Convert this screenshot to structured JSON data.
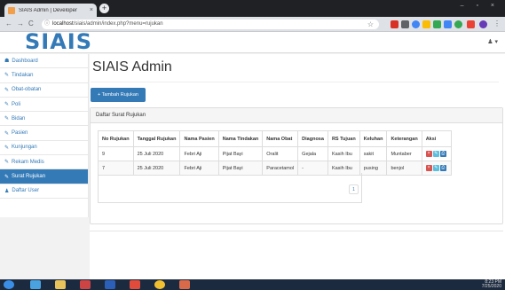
{
  "browser": {
    "tab_title": "SIAIS Admin | Developer",
    "tab_close": "×",
    "new_tab": "+",
    "window_controls": "– ▫ ×",
    "url_host": "localhost",
    "url_path": "/siais/admin/index.php?menu=rujukan",
    "nav_back": "←",
    "nav_forward": "→",
    "nav_reload": "C",
    "info_icon": "ⓘ",
    "star": "☆"
  },
  "app": {
    "brand": "SIAIS",
    "user_menu": "♟ ▾"
  },
  "sidebar": {
    "items": [
      {
        "icon": "☗",
        "label": "Dashboard"
      },
      {
        "icon": "✎",
        "label": "Tindakan"
      },
      {
        "icon": "✎",
        "label": "Obat-obatan"
      },
      {
        "icon": "✎",
        "label": "Poli"
      },
      {
        "icon": "✎",
        "label": "Bidan"
      },
      {
        "icon": "✎",
        "label": "Pasien"
      },
      {
        "icon": "✎",
        "label": "Kunjungan"
      },
      {
        "icon": "✎",
        "label": "Rekam Medis"
      },
      {
        "icon": "✎",
        "label": "Surat Rujukan"
      },
      {
        "icon": "♟",
        "label": "Daftar User"
      }
    ],
    "active_index": 8
  },
  "main": {
    "title": "SIAIS Admin",
    "add_button": "+ Tambah Rujukan",
    "panel_title": "Daftar Surat Rujukan",
    "table": {
      "headers": [
        "No Rujukan",
        "Tanggal Rujukan",
        "Nama Pasien",
        "Nama Tindakan",
        "Nama Obat",
        "Diagnosa",
        "RS Tujuan",
        "Keluhan",
        "Keterangan",
        "Aksi"
      ],
      "rows": [
        [
          "9",
          "25 Juli 2020",
          "Febri Aji",
          "Pijat Bayi",
          "Oralit",
          "Gejala",
          "Kasih Ibu",
          "sakit",
          "Muntaber"
        ],
        [
          "7",
          "25 Juli 2020",
          "Febri Aji",
          "Pijat Bayi",
          "Paracetamol",
          "-",
          "Kasih Ibu",
          "pusing",
          "benjol"
        ]
      ],
      "action_icons": [
        "×",
        "✎",
        "⎙"
      ]
    },
    "pager": "1"
  },
  "taskbar": {
    "clock": "8:23 PM",
    "date": "7/25/2020"
  },
  "colors": {
    "primary": "#337ab7",
    "delete": "#d9534f",
    "edit": "#5bc0de",
    "print": "#337ab7"
  }
}
